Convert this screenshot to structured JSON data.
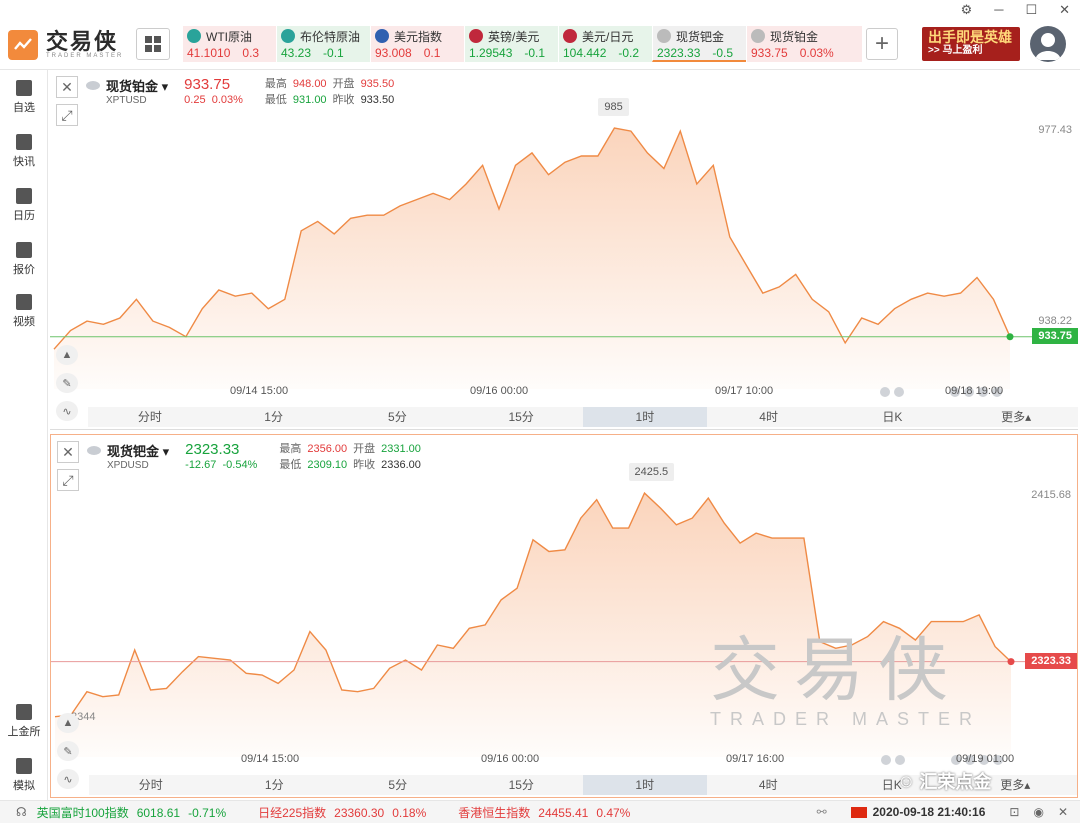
{
  "window": {
    "controls": [
      "⚙",
      "─",
      "☐",
      "✕"
    ]
  },
  "app": {
    "brand_cn": "交易侠",
    "brand_en": "TRADER MASTER"
  },
  "tickers": [
    {
      "name": "WTI原油",
      "icon": "oil-icon",
      "price": "41.1010",
      "change": "0.3",
      "tone": "red"
    },
    {
      "name": "布伦特原油",
      "icon": "oil-icon",
      "price": "43.23",
      "change": "-0.1",
      "tone": "green"
    },
    {
      "name": "美元指数",
      "icon": "us-flag-icon",
      "price": "93.008",
      "change": "0.1",
      "tone": "red"
    },
    {
      "name": "英镑/美元",
      "icon": "uk-flag-icon",
      "price": "1.29543",
      "change": "-0.1",
      "tone": "green"
    },
    {
      "name": "美元/日元",
      "icon": "us-jp-flag-icon",
      "price": "104.442",
      "change": "-0.2",
      "tone": "green"
    },
    {
      "name": "现货钯金",
      "icon": "coin-icon",
      "price": "2323.33",
      "change": "-0.5",
      "tone": "gray"
    },
    {
      "name": "现货铂金",
      "icon": "coin-icon",
      "price": "933.75",
      "change": "0.03%",
      "tone": "red"
    }
  ],
  "promo": {
    "line1": "出手即是英雄",
    "line2": ">> 马上盈利"
  },
  "sidebar": [
    {
      "label": "自选",
      "icon": "bookmark-icon"
    },
    {
      "label": "快讯",
      "icon": "news-icon"
    },
    {
      "label": "日历",
      "icon": "calendar-icon"
    },
    {
      "label": "报价",
      "icon": "quote-icon"
    },
    {
      "label": "视频",
      "icon": "video-icon"
    },
    {
      "label": "上金所",
      "icon": "exchange-icon"
    },
    {
      "label": "模拟",
      "icon": "wallet-icon"
    }
  ],
  "panels": [
    {
      "name": "现货铂金",
      "symbol": "XPTUSD",
      "price": "933.75",
      "change": "0.25",
      "change_pct": "0.03%",
      "high_label": "最高",
      "high": "948.00",
      "open_label": "开盘",
      "open": "935.50",
      "low_label": "最低",
      "low": "931.00",
      "prev_label": "昨收",
      "prev": "933.50",
      "peak": "985",
      "axis_label": "977.43",
      "axis_label2": "938.22",
      "current_tag": "933.75",
      "x_ticks": [
        "09/14 15:00",
        "09/16 00:00",
        "09/17 10:00",
        "09/18 19:00"
      ],
      "series": [
        920,
        926,
        929,
        928,
        930,
        936,
        929,
        927,
        924,
        933,
        939,
        937,
        938,
        933,
        936,
        958,
        961,
        957,
        962,
        963,
        963,
        966,
        968,
        970,
        968,
        973,
        979,
        965,
        979,
        983,
        976,
        980,
        982,
        982,
        991,
        990,
        983,
        978,
        990,
        973,
        979,
        956,
        947,
        938,
        940,
        944,
        936,
        932,
        922,
        930,
        928,
        933,
        936,
        938,
        937,
        938,
        943,
        936,
        924
      ],
      "color": "#f5a06a",
      "line_color": "#ef8a45",
      "tag_color": "#2fb343",
      "ref_color": "#6dc46b"
    },
    {
      "name": "现货钯金",
      "symbol": "XPDUSD",
      "price": "2323.33",
      "change": "-12.67",
      "change_pct": "-0.54%",
      "high_label": "最高",
      "high": "2356.00",
      "open_label": "开盘",
      "open": "2331.00",
      "low_label": "最低",
      "low": "2309.10",
      "prev_label": "昨收",
      "prev": "2336.00",
      "peak": "2425.5",
      "axis_label": "2415.68",
      "axis_label2": "2344",
      "current_tag": "2323.33",
      "x_ticks": [
        "09/14 15:00",
        "09/16 00:00",
        "09/17 16:00",
        "09/19 01:00"
      ],
      "series": [
        2290,
        2291,
        2305,
        2302,
        2303,
        2330,
        2306,
        2307,
        2317,
        2326,
        2325,
        2324,
        2316,
        2315,
        2310,
        2318,
        2341,
        2330,
        2306,
        2305,
        2307,
        2319,
        2324,
        2318,
        2333,
        2331,
        2343,
        2345,
        2360,
        2367,
        2396,
        2389,
        2390,
        2409,
        2420,
        2403,
        2403,
        2424,
        2415,
        2405,
        2409,
        2421,
        2406,
        2394,
        2400,
        2397,
        2397,
        2397,
        2335,
        2331,
        2333,
        2338,
        2347,
        2343,
        2336,
        2347,
        2347,
        2347,
        2351,
        2332,
        2323
      ],
      "color": "#f5a06a",
      "line_color": "#ef8a45",
      "tag_color": "#e64a4a",
      "ref_color": "#e89a9a"
    }
  ],
  "timeframes": [
    "分时",
    "1分",
    "5分",
    "15分",
    "1时",
    "4时",
    "日K",
    "更多▴"
  ],
  "active_timeframe": "1时",
  "watermark": {
    "cn": "交易侠",
    "en": "TRADER MASTER"
  },
  "bottom": {
    "items": [
      {
        "name": "英国富时100指数",
        "value": "6018.61",
        "change": "-0.71%",
        "tone": "dn"
      },
      {
        "name": "日经225指数",
        "value": "23360.30",
        "change": "0.18%",
        "tone": "up"
      },
      {
        "name": "香港恒生指数",
        "value": "24455.41",
        "change": "0.47%",
        "tone": "up"
      }
    ],
    "datetime": "2020-09-18 21:40:16"
  },
  "mp_badge": "汇荣点金"
}
